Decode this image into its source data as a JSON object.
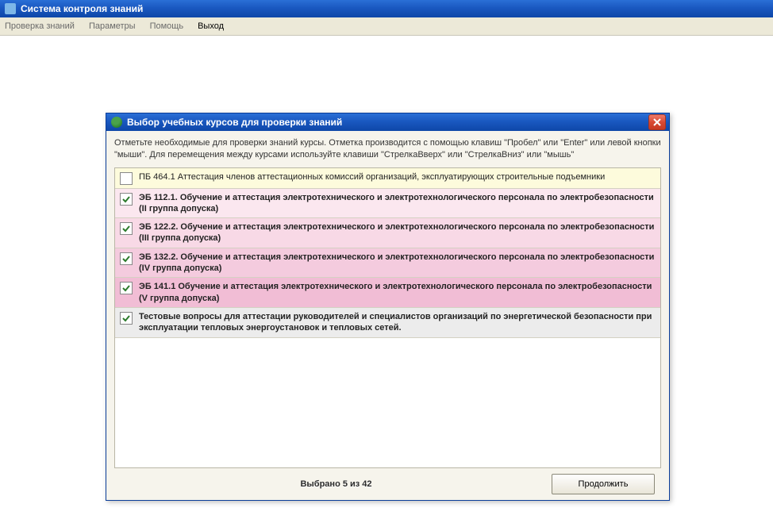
{
  "main_window": {
    "title": "Система контроля знаний"
  },
  "menubar": {
    "items": [
      "Проверка знаний",
      "Параметры",
      "Помощь",
      "Выход"
    ]
  },
  "dialog": {
    "title": "Выбор учебных курсов для проверки знаний",
    "instructions": "Отметьте необходимые для проверки знаний курсы. Отметка производится с помощью клавиш \"Пробел\" или \"Enter\" или левой кнопки \"мыши\". Для перемещения между курсами используйте клавиши \"СтрелкаВверх\" или \"СтрелкаВниз\" или \"мышь\"",
    "courses": [
      {
        "checked": false,
        "bold": false,
        "bg": "bg-yellow",
        "label": "ПБ 464.1 Аттестация членов аттестационных комиссий организаций, эксплуатирующих строительные подъемники"
      },
      {
        "checked": true,
        "bold": true,
        "bg": "bg-pink1",
        "label": "ЭБ 112.1. Обучение и аттестация электротехнического и электротехнологического персонала по электробезопасности (II группа допуска)"
      },
      {
        "checked": true,
        "bold": true,
        "bg": "bg-pink2",
        "label": "ЭБ 122.2. Обучение и аттестация электротехнического и электротехнологического персонала по электробезопасности (III группа допуска)"
      },
      {
        "checked": true,
        "bold": true,
        "bg": "bg-pink3",
        "label": "ЭБ 132.2. Обучение и аттестация электротехнического и электротехнологического персонала по электробезопасности (IV группа допуска)"
      },
      {
        "checked": true,
        "bold": true,
        "bg": "bg-pink4",
        "label": "ЭБ 141.1 Обучение и аттестация электротехнического и электротехнологического персонала по электробезопасности (V группа допуска)"
      },
      {
        "checked": true,
        "bold": true,
        "bg": "bg-grey",
        "label": "Тестовые вопросы для аттестации руководителей и специалистов организаций по энергетической безопасности при эксплуатации тепловых энергоустановок и тепловых сетей."
      }
    ],
    "selected_count_label": "Выбрано 5 из 42",
    "continue_label": "Продолжить"
  }
}
